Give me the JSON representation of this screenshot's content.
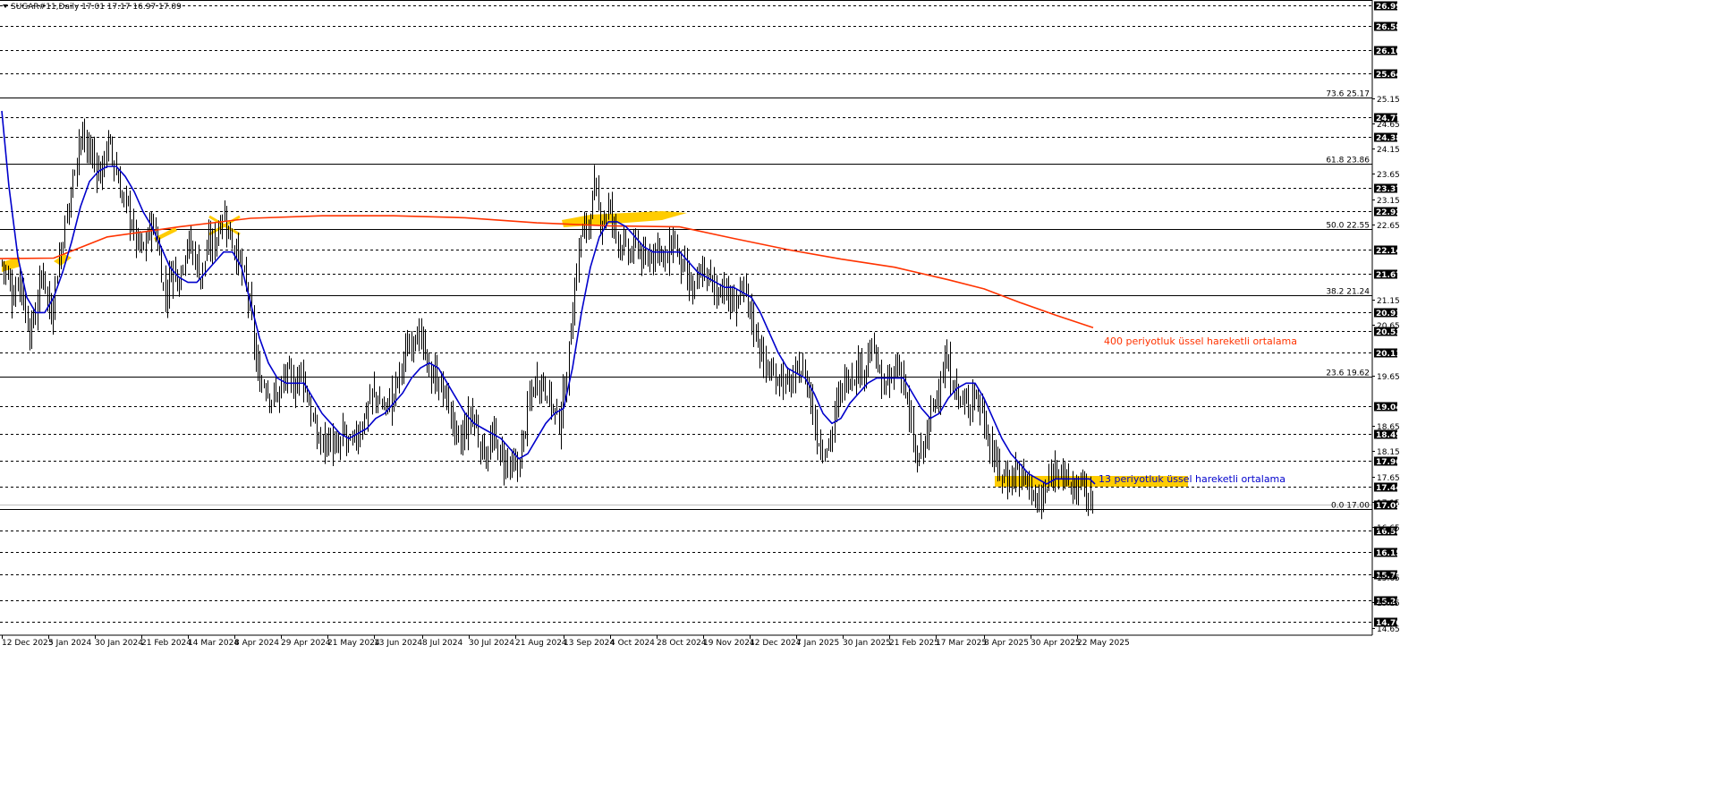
{
  "header": {
    "symbol_line": "SUGAR#11,Daily  17.01 17.17 16.97 17.09"
  },
  "chart_data": {
    "type": "candlestick",
    "y_range": [
      14.5,
      27.1
    ],
    "price_levels": [
      26.99,
      26.58,
      26.1,
      25.64,
      24.77,
      24.38,
      23.37,
      22.92,
      22.14,
      21.67,
      20.91,
      20.53,
      20.11,
      19.04,
      18.49,
      17.96,
      17.44,
      16.58,
      16.15,
      15.7,
      15.2,
      14.76
    ],
    "axis_ticks": [
      25.15,
      24.65,
      24.15,
      23.65,
      23.15,
      22.65,
      21.15,
      20.65,
      19.65,
      18.65,
      18.15,
      17.65,
      17.15,
      16.65,
      15.65,
      15.15,
      14.65
    ],
    "fib_levels": [
      {
        "label": "73.6 25.17",
        "price": 25.17
      },
      {
        "label": "61.8 23.86",
        "price": 23.86
      },
      {
        "label": "50.0 22.55",
        "price": 22.55
      },
      {
        "label": "38.2 21.24",
        "price": 21.24
      },
      {
        "label": "23.6 19.62",
        "price": 19.62
      },
      {
        "label": "0.0 17.00",
        "price": 17.0
      }
    ],
    "current_price": 17.09,
    "x_labels": [
      "12 Dec 2023",
      "5 Jan 2024",
      "30 Jan 2024",
      "21 Feb 2024",
      "14 Mar 2024",
      "8 Apr 2024",
      "29 Apr 2024",
      "21 May 2024",
      "13 Jun 2024",
      "8 Jul 2024",
      "30 Jul 2024",
      "21 Aug 2024",
      "13 Sep 2024",
      "4 Oct 2024",
      "28 Oct 2024",
      "19 Nov 2024",
      "12 Dec 2024",
      "7 Jan 2025",
      "30 Jan 2025",
      "21 Feb 2025",
      "17 Mar 2025",
      "8 Apr 2025",
      "30 Apr 2025",
      "22 May 2025"
    ],
    "price_path": [
      [
        0,
        22.0
      ],
      [
        8,
        21.6
      ],
      [
        14,
        21.2
      ],
      [
        22,
        21.7
      ],
      [
        28,
        20.9
      ],
      [
        34,
        20.5
      ],
      [
        40,
        21.0
      ],
      [
        48,
        21.8
      ],
      [
        56,
        20.8
      ],
      [
        64,
        21.8
      ],
      [
        72,
        22.6
      ],
      [
        80,
        23.4
      ],
      [
        88,
        24.4
      ],
      [
        96,
        24.2
      ],
      [
        104,
        24.0
      ],
      [
        112,
        23.6
      ],
      [
        120,
        24.3
      ],
      [
        128,
        23.8
      ],
      [
        136,
        23.2
      ],
      [
        144,
        22.9
      ],
      [
        152,
        22.3
      ],
      [
        160,
        22.1
      ],
      [
        168,
        22.7
      ],
      [
        176,
        22.3
      ],
      [
        184,
        21.2
      ],
      [
        192,
        21.8
      ],
      [
        200,
        21.6
      ],
      [
        208,
        22.3
      ],
      [
        216,
        22.1
      ],
      [
        224,
        21.6
      ],
      [
        232,
        22.2
      ],
      [
        240,
        22.3
      ],
      [
        248,
        22.9
      ],
      [
        256,
        22.5
      ],
      [
        264,
        22.1
      ],
      [
        272,
        21.6
      ],
      [
        280,
        20.9
      ],
      [
        288,
        19.6
      ],
      [
        296,
        19.5
      ],
      [
        304,
        19.2
      ],
      [
        312,
        19.3
      ],
      [
        320,
        19.7
      ],
      [
        328,
        19.4
      ],
      [
        336,
        19.8
      ],
      [
        344,
        19.2
      ],
      [
        352,
        18.5
      ],
      [
        360,
        18.3
      ],
      [
        368,
        18.4
      ],
      [
        376,
        18.1
      ],
      [
        384,
        18.5
      ],
      [
        392,
        18.2
      ],
      [
        400,
        18.5
      ],
      [
        408,
        18.9
      ],
      [
        416,
        19.3
      ],
      [
        424,
        19.1
      ],
      [
        432,
        19.0
      ],
      [
        440,
        19.3
      ],
      [
        448,
        19.8
      ],
      [
        456,
        20.2
      ],
      [
        464,
        20.6
      ],
      [
        472,
        20.2
      ],
      [
        480,
        19.7
      ],
      [
        488,
        19.6
      ],
      [
        496,
        19.3
      ],
      [
        504,
        18.9
      ],
      [
        512,
        18.2
      ],
      [
        520,
        18.6
      ],
      [
        528,
        18.9
      ],
      [
        536,
        18.3
      ],
      [
        544,
        18.1
      ],
      [
        552,
        18.4
      ],
      [
        560,
        18.0
      ],
      [
        568,
        17.9
      ],
      [
        576,
        17.7
      ],
      [
        584,
        18.3
      ],
      [
        592,
        19.2
      ],
      [
        600,
        19.6
      ],
      [
        608,
        19.5
      ],
      [
        616,
        19.1
      ],
      [
        624,
        18.7
      ],
      [
        632,
        19.4
      ],
      [
        640,
        21.0
      ],
      [
        648,
        22.4
      ],
      [
        656,
        22.6
      ],
      [
        664,
        23.3
      ],
      [
        672,
        22.7
      ],
      [
        680,
        23.0
      ],
      [
        688,
        22.5
      ],
      [
        696,
        22.2
      ],
      [
        704,
        22.0
      ],
      [
        712,
        22.3
      ],
      [
        720,
        21.8
      ],
      [
        728,
        22.1
      ],
      [
        736,
        22.3
      ],
      [
        744,
        21.8
      ],
      [
        752,
        22.4
      ],
      [
        760,
        21.9
      ],
      [
        768,
        21.5
      ],
      [
        776,
        21.3
      ],
      [
        784,
        21.7
      ],
      [
        792,
        21.6
      ],
      [
        800,
        21.3
      ],
      [
        808,
        21.5
      ],
      [
        816,
        21.0
      ],
      [
        824,
        21.2
      ],
      [
        832,
        21.3
      ],
      [
        840,
        20.8
      ],
      [
        848,
        20.3
      ],
      [
        856,
        19.8
      ],
      [
        864,
        19.6
      ],
      [
        872,
        19.7
      ],
      [
        880,
        19.4
      ],
      [
        888,
        19.6
      ],
      [
        896,
        19.8
      ],
      [
        904,
        19.4
      ],
      [
        912,
        18.5
      ],
      [
        920,
        18.2
      ],
      [
        928,
        18.4
      ],
      [
        936,
        19.1
      ],
      [
        944,
        19.6
      ],
      [
        952,
        19.7
      ],
      [
        960,
        19.8
      ],
      [
        968,
        19.9
      ],
      [
        976,
        20.2
      ],
      [
        984,
        19.5
      ],
      [
        992,
        19.4
      ],
      [
        1000,
        19.8
      ],
      [
        1008,
        19.8
      ],
      [
        1016,
        18.8
      ],
      [
        1024,
        17.9
      ],
      [
        1032,
        18.2
      ],
      [
        1040,
        18.8
      ],
      [
        1048,
        19.4
      ],
      [
        1056,
        19.9
      ],
      [
        1064,
        19.6
      ],
      [
        1072,
        19.2
      ],
      [
        1080,
        19.0
      ],
      [
        1088,
        19.4
      ],
      [
        1096,
        19.0
      ],
      [
        1104,
        18.5
      ],
      [
        1112,
        17.9
      ],
      [
        1120,
        17.7
      ],
      [
        1128,
        17.6
      ],
      [
        1136,
        17.8
      ],
      [
        1144,
        17.6
      ],
      [
        1152,
        17.5
      ],
      [
        1160,
        17.0
      ],
      [
        1168,
        17.3
      ],
      [
        1176,
        17.7
      ],
      [
        1184,
        18.0
      ],
      [
        1192,
        17.5
      ],
      [
        1200,
        17.4
      ],
      [
        1208,
        17.5
      ],
      [
        1216,
        17.2
      ],
      [
        1222,
        17.05
      ]
    ],
    "ema13_path": [
      [
        2,
        24.9
      ],
      [
        10,
        23.4
      ],
      [
        20,
        22.0
      ],
      [
        30,
        21.2
      ],
      [
        40,
        20.9
      ],
      [
        50,
        20.9
      ],
      [
        60,
        21.2
      ],
      [
        70,
        21.7
      ],
      [
        80,
        22.3
      ],
      [
        90,
        23.0
      ],
      [
        100,
        23.5
      ],
      [
        110,
        23.7
      ],
      [
        120,
        23.8
      ],
      [
        130,
        23.8
      ],
      [
        140,
        23.6
      ],
      [
        150,
        23.3
      ],
      [
        160,
        22.9
      ],
      [
        170,
        22.6
      ],
      [
        180,
        22.2
      ],
      [
        190,
        21.8
      ],
      [
        200,
        21.6
      ],
      [
        210,
        21.5
      ],
      [
        220,
        21.5
      ],
      [
        230,
        21.7
      ],
      [
        240,
        21.9
      ],
      [
        250,
        22.1
      ],
      [
        260,
        22.1
      ],
      [
        270,
        21.8
      ],
      [
        280,
        21.1
      ],
      [
        290,
        20.4
      ],
      [
        300,
        19.9
      ],
      [
        310,
        19.6
      ],
      [
        320,
        19.5
      ],
      [
        330,
        19.5
      ],
      [
        340,
        19.5
      ],
      [
        350,
        19.2
      ],
      [
        360,
        18.9
      ],
      [
        370,
        18.7
      ],
      [
        380,
        18.5
      ],
      [
        390,
        18.4
      ],
      [
        400,
        18.5
      ],
      [
        410,
        18.6
      ],
      [
        420,
        18.8
      ],
      [
        430,
        18.9
      ],
      [
        440,
        19.1
      ],
      [
        450,
        19.3
      ],
      [
        460,
        19.6
      ],
      [
        470,
        19.8
      ],
      [
        480,
        19.9
      ],
      [
        490,
        19.8
      ],
      [
        500,
        19.5
      ],
      [
        510,
        19.2
      ],
      [
        520,
        18.9
      ],
      [
        530,
        18.7
      ],
      [
        540,
        18.6
      ],
      [
        550,
        18.5
      ],
      [
        560,
        18.4
      ],
      [
        570,
        18.2
      ],
      [
        580,
        18.0
      ],
      [
        590,
        18.1
      ],
      [
        600,
        18.4
      ],
      [
        610,
        18.7
      ],
      [
        620,
        18.9
      ],
      [
        630,
        19.0
      ],
      [
        640,
        19.8
      ],
      [
        650,
        20.9
      ],
      [
        660,
        21.8
      ],
      [
        670,
        22.4
      ],
      [
        680,
        22.7
      ],
      [
        690,
        22.7
      ],
      [
        700,
        22.6
      ],
      [
        710,
        22.4
      ],
      [
        720,
        22.2
      ],
      [
        730,
        22.1
      ],
      [
        740,
        22.1
      ],
      [
        750,
        22.1
      ],
      [
        760,
        22.1
      ],
      [
        770,
        21.9
      ],
      [
        780,
        21.7
      ],
      [
        790,
        21.6
      ],
      [
        800,
        21.5
      ],
      [
        810,
        21.4
      ],
      [
        820,
        21.4
      ],
      [
        830,
        21.3
      ],
      [
        840,
        21.2
      ],
      [
        850,
        20.9
      ],
      [
        860,
        20.5
      ],
      [
        870,
        20.1
      ],
      [
        880,
        19.8
      ],
      [
        890,
        19.7
      ],
      [
        900,
        19.6
      ],
      [
        910,
        19.3
      ],
      [
        920,
        18.9
      ],
      [
        930,
        18.7
      ],
      [
        940,
        18.8
      ],
      [
        950,
        19.1
      ],
      [
        960,
        19.3
      ],
      [
        970,
        19.5
      ],
      [
        980,
        19.6
      ],
      [
        990,
        19.6
      ],
      [
        1000,
        19.6
      ],
      [
        1010,
        19.6
      ],
      [
        1020,
        19.3
      ],
      [
        1030,
        19.0
      ],
      [
        1040,
        18.8
      ],
      [
        1050,
        18.9
      ],
      [
        1060,
        19.2
      ],
      [
        1070,
        19.4
      ],
      [
        1080,
        19.5
      ],
      [
        1090,
        19.5
      ],
      [
        1100,
        19.2
      ],
      [
        1110,
        18.8
      ],
      [
        1120,
        18.4
      ],
      [
        1130,
        18.1
      ],
      [
        1140,
        17.9
      ],
      [
        1150,
        17.7
      ],
      [
        1160,
        17.6
      ],
      [
        1170,
        17.5
      ],
      [
        1180,
        17.6
      ],
      [
        1190,
        17.6
      ],
      [
        1200,
        17.6
      ],
      [
        1210,
        17.6
      ],
      [
        1218,
        17.6
      ],
      [
        1224,
        17.5
      ]
    ],
    "ema400_path": [
      [
        0,
        21.97
      ],
      [
        60,
        21.98
      ],
      [
        120,
        22.4
      ],
      [
        200,
        22.6
      ],
      [
        280,
        22.77
      ],
      [
        360,
        22.82
      ],
      [
        440,
        22.82
      ],
      [
        520,
        22.78
      ],
      [
        600,
        22.68
      ],
      [
        680,
        22.62
      ],
      [
        760,
        22.6
      ],
      [
        820,
        22.37
      ],
      [
        880,
        22.15
      ],
      [
        940,
        21.96
      ],
      [
        1000,
        21.8
      ],
      [
        1060,
        21.55
      ],
      [
        1100,
        21.37
      ],
      [
        1140,
        21.1
      ],
      [
        1180,
        20.85
      ],
      [
        1222,
        20.6
      ]
    ],
    "annotations": {
      "ema400_label": "400 periyotluk üssel hareketli ortalama",
      "ema13_label": "13 periyotluk üssel hareketli ortalama"
    },
    "colors": {
      "candles": "#000000",
      "ema13": "#0000cc",
      "ema400": "#ff3300",
      "highlight": "#ffcc00",
      "grid_dash": "#000000"
    }
  }
}
